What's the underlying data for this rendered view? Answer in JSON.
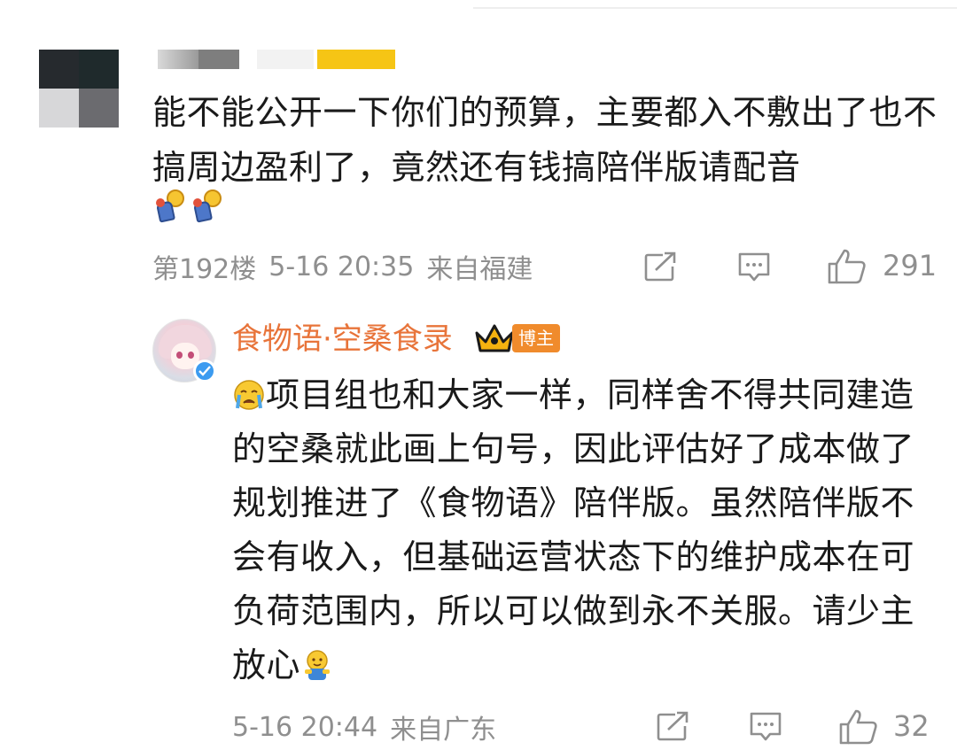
{
  "comment1": {
    "text": "能不能公开一下你们的预算，主要都入不敷出了也不搞周边盈利了，竟然还有钱搞陪伴版请配音",
    "emoji": "pin-holding-emoji",
    "floor": "第192楼",
    "time": "5-16 20:35",
    "location": "来自福建",
    "likes": "291"
  },
  "comment2": {
    "author": "食物语·空桑食录",
    "badge": "博主",
    "text_before": "项目组也和大家一样，同样舍不得共同建造的空桑就此画上句号，因此评估好了成本做了规划推进了《食物语》陪伴版。虽然陪伴版不会有收入，但基础运营状态下的维护成本在可负荷范围内，所以可以做到永不关服。请少主放心",
    "lead_emoji": "crying-face-emoji",
    "trail_emoji": "hug-emoji",
    "time": "5-16 20:44",
    "location": "来自广东",
    "likes": "32"
  },
  "colors": {
    "author": "#e8743a",
    "badge": "#f08b2c",
    "meta": "#8f8f8f",
    "verify": "#3c9bf0"
  }
}
